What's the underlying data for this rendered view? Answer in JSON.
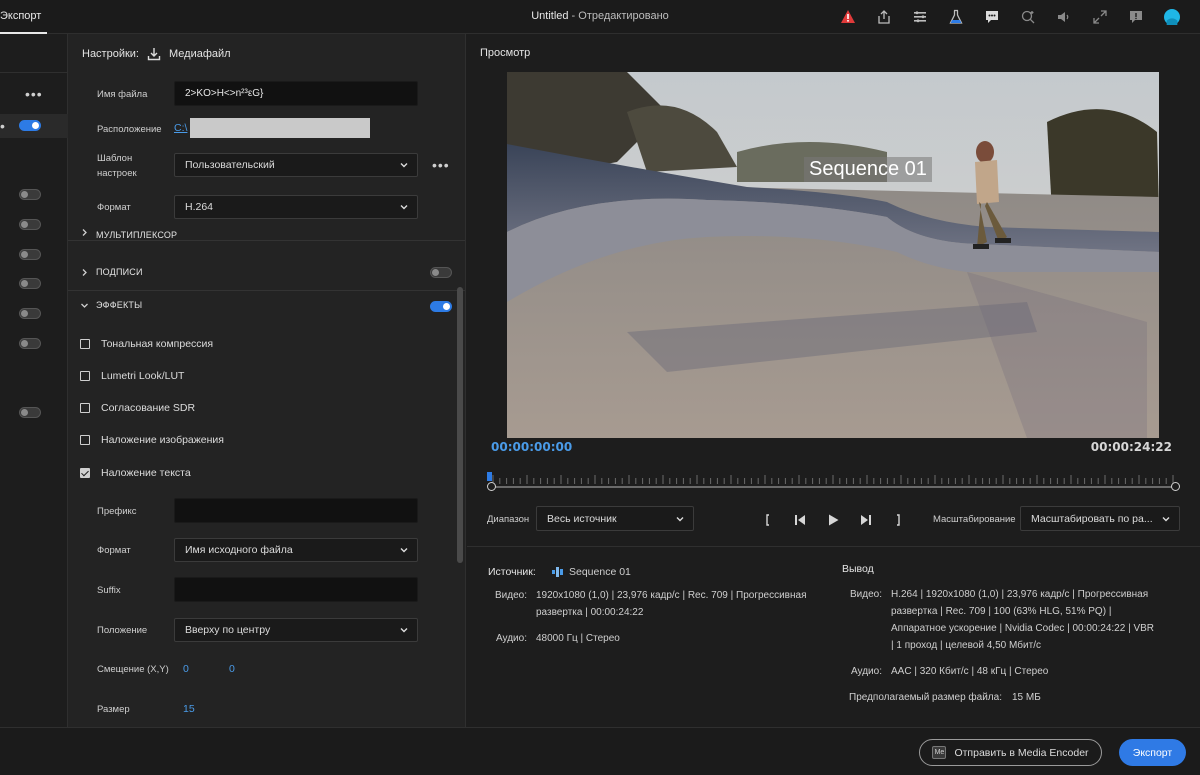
{
  "topbar": {
    "tab_label": "Экспорт",
    "doc_name": "Untitled",
    "doc_status": " - Отредактировано",
    "icons": [
      "warning-icon",
      "share-icon",
      "menu-list-icon",
      "beaker-icon",
      "comment-icon",
      "zoom-icon",
      "volume-icon",
      "fullscreen-icon",
      "feedback-icon",
      "avatar-icon"
    ],
    "warning_color": "#e03a3a",
    "avatar_color": "#1fb6e6"
  },
  "left": {
    "more_dots": "•••"
  },
  "settings": {
    "header_label": "Настройки:",
    "destination": "Медиафайл",
    "filename_label": "Имя файла",
    "filename_value": "2>KO>H<>n²³εG}",
    "location_label": "Расположение",
    "location_value": "C:\\",
    "preset_label_1": "Шаблон",
    "preset_label_2": "настроек",
    "preset_value": "Пользовательский",
    "format_label": "Формат",
    "format_value": "H.264",
    "more_dots": "•••",
    "sections": {
      "multiplexer": "МУЛЬТИПЛЕКСОР",
      "captions": "ПОДПИСИ",
      "effects": "ЭФФЕКТЫ"
    },
    "effects": [
      {
        "label": "Тональная компрессия",
        "checked": false
      },
      {
        "label": "Lumetri Look/LUT",
        "checked": false
      },
      {
        "label": "Согласование SDR",
        "checked": false
      },
      {
        "label": "Наложение изображения",
        "checked": false
      },
      {
        "label": "Наложение текста",
        "checked": true
      }
    ],
    "text_overlay": {
      "prefix_label": "Префикс",
      "prefix_value": "",
      "format_label": "Формат",
      "format_value": "Имя исходного файла",
      "suffix_label": "Suffix",
      "suffix_value": "",
      "position_label": "Положение",
      "position_value": "Вверху по центру",
      "offset_label": "Смещение (X,Y)",
      "offset_x": "0",
      "offset_y": "0",
      "size_label": "Размер",
      "size_value": "15"
    }
  },
  "preview": {
    "title": "Просмотр",
    "overlay_text": "Sequence 01",
    "timecode_start": "00:00:00:00",
    "timecode_end": "00:00:24:22",
    "range_label": "Диапазон",
    "range_value": "Весь источник",
    "scale_label": "Масштабирование",
    "scale_value": "Масштабировать по ра...",
    "accent": "#4a9be8"
  },
  "info": {
    "source_label": "Источник:",
    "source_name": "Sequence 01",
    "source_video_key": "Видео:",
    "source_video_l1": "1920x1080 (1,0)  |  23,976 кадр/с  |  Rec. 709  |  Прогрессивная",
    "source_video_l2": "развертка  |  00:00:24:22",
    "source_audio_key": "Аудио:",
    "source_audio": "48000 Гц  |  Стерео",
    "output_label": "Вывод",
    "output_video_key": "Видео:",
    "output_video_l1": "H.264  |  1920x1080 (1,0)  |  23,976 кадр/с  |  Прогрессивная",
    "output_video_l2": "развертка  |  Rec. 709  |  100 (63% HLG, 51% PQ)  |",
    "output_video_l3": "Аппаратное ускорение  |  Nvidia Codec  |  00:00:24:22  |  VBR",
    "output_video_l4": "|  1 проход  |  целевой 4,50 Мбит/с",
    "output_audio_key": "Аудио:",
    "output_audio": "AAC  |  320 Кбит/с  |  48 кГц  |  Стерео",
    "filesize_label": "Предполагаемый размер файла:",
    "filesize_value": "15 МБ"
  },
  "bottom": {
    "media_encoder_badge": "Me",
    "send_label": "Отправить в Media Encoder",
    "export_label": "Экспорт"
  }
}
